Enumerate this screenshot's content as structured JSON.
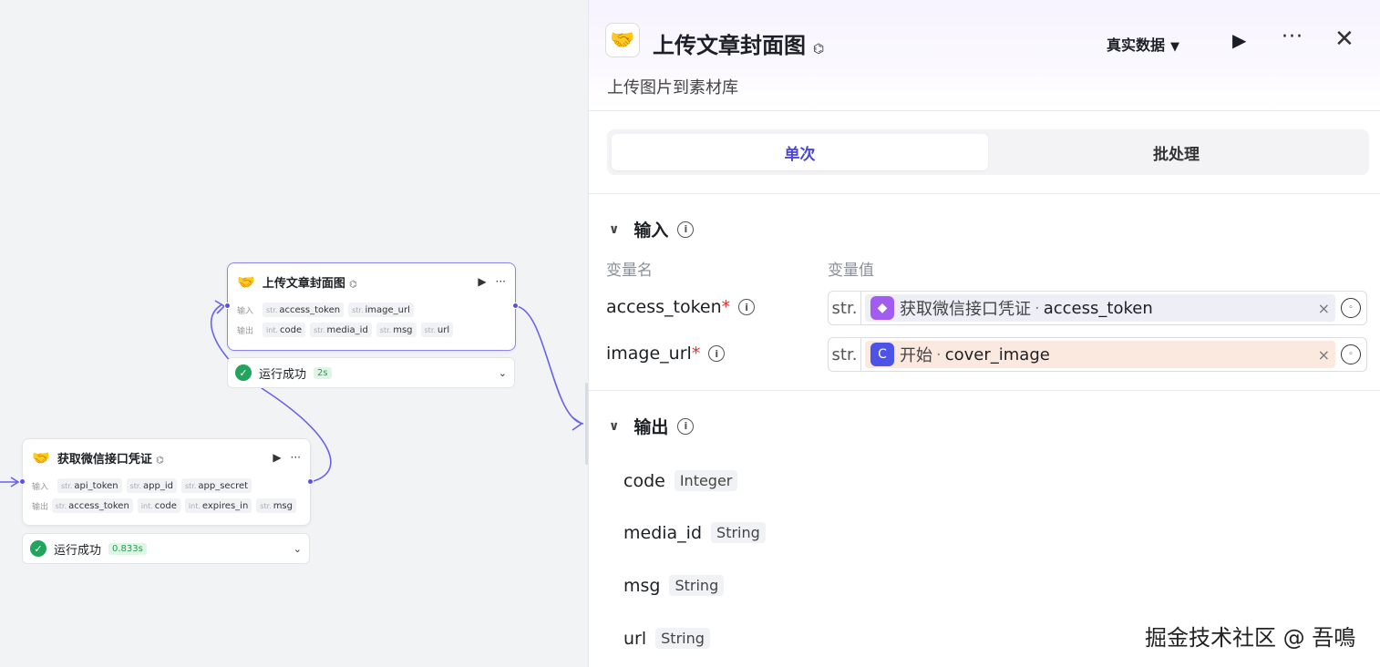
{
  "canvas": {
    "node_main": {
      "title": "上传文章封面图",
      "title_mark": "⌬",
      "emoji": "🤝",
      "play": "▶",
      "more": "···",
      "input_label": "输入",
      "output_label": "输出",
      "inputs": [
        {
          "type": "str.",
          "name": "access_token"
        },
        {
          "type": "str.",
          "name": "image_url"
        }
      ],
      "outputs": [
        {
          "type": "int.",
          "name": "code"
        },
        {
          "type": "str.",
          "name": "media_id"
        },
        {
          "type": "str.",
          "name": "msg"
        },
        {
          "type": "str.",
          "name": "url"
        }
      ],
      "status": "运行成功",
      "time": "2s"
    },
    "node_token": {
      "title": "获取微信接口凭证",
      "title_mark": "⌬",
      "emoji": "🤝",
      "play": "▶",
      "more": "···",
      "input_label": "输入",
      "output_label": "输出",
      "inputs": [
        {
          "type": "str.",
          "name": "api_token"
        },
        {
          "type": "str.",
          "name": "app_id"
        },
        {
          "type": "str.",
          "name": "app_secret"
        }
      ],
      "outputs": [
        {
          "type": "str.",
          "name": "access_token"
        },
        {
          "type": "int.",
          "name": "code"
        },
        {
          "type": "int.",
          "name": "expires_in"
        },
        {
          "type": "str.",
          "name": "msg"
        }
      ],
      "status": "运行成功",
      "time": "0.833s"
    }
  },
  "panel": {
    "title": "上传文章封面图",
    "title_mark": "⌬",
    "emoji": "🤝",
    "description": "上传图片到素材库",
    "mode": "真实数据",
    "mode_caret": "▼",
    "play": "▶",
    "more": "···",
    "close": "✕",
    "tabs": [
      "单次",
      "批处理"
    ],
    "input_section": "输入",
    "col_name": "变量名",
    "col_value": "变量值",
    "inputs": [
      {
        "name": "access_token",
        "required": "*",
        "type": "str.",
        "source": "获取微信接口凭证",
        "field": "access_token",
        "color": "#a35cf0"
      },
      {
        "name": "image_url",
        "required": "*",
        "type": "str.",
        "source": "开始",
        "field": "cover_image",
        "color": "#4c53e6"
      }
    ],
    "output_section": "输出",
    "outputs": [
      {
        "name": "code",
        "type": "Integer"
      },
      {
        "name": "media_id",
        "type": "String"
      },
      {
        "name": "msg",
        "type": "String"
      },
      {
        "name": "url",
        "type": "String"
      }
    ]
  },
  "watermark": "掘金技术社区 @ 吾鳴"
}
